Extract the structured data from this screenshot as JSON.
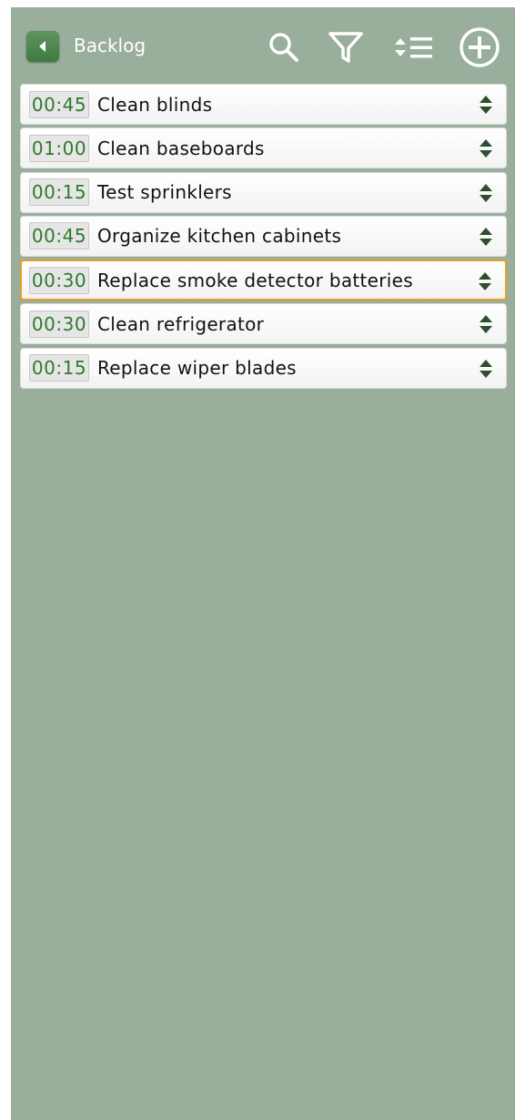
{
  "header": {
    "title": "Backlog",
    "icons": {
      "back": "chevron-left-icon",
      "search": "search-icon",
      "filter": "filter-icon",
      "sort": "sort-list-icon",
      "add": "add-circle-icon"
    }
  },
  "colors": {
    "background": "#9aae9c",
    "accent_green": "#3e7a40",
    "duration_text": "#2f7a2f",
    "selected_border": "#e8a020"
  },
  "tasks": [
    {
      "duration": "00:45",
      "name": "Clean blinds",
      "selected": false
    },
    {
      "duration": "01:00",
      "name": "Clean baseboards",
      "selected": false
    },
    {
      "duration": "00:15",
      "name": "Test sprinklers",
      "selected": false
    },
    {
      "duration": "00:45",
      "name": "Organize kitchen cabinets",
      "selected": false
    },
    {
      "duration": "00:30",
      "name": "Replace smoke detector batteries",
      "selected": true
    },
    {
      "duration": "00:30",
      "name": "Clean refrigerator",
      "selected": false
    },
    {
      "duration": "00:15",
      "name": "Replace wiper blades",
      "selected": false
    }
  ]
}
